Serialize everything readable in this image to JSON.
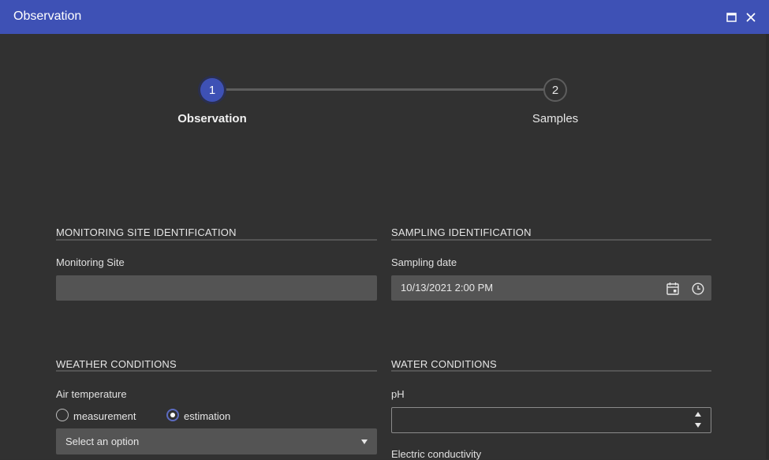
{
  "window": {
    "title": "Observation"
  },
  "stepper": {
    "steps": [
      {
        "number": "1",
        "label": "Observation"
      },
      {
        "number": "2",
        "label": "Samples"
      }
    ]
  },
  "monitoring_site": {
    "section_title": "MONITORING SITE IDENTIFICATION",
    "field_label": "Monitoring Site",
    "value": ""
  },
  "sampling": {
    "section_title": "SAMPLING IDENTIFICATION",
    "field_label": "Sampling date",
    "value": "10/13/2021 2:00 PM"
  },
  "weather": {
    "section_title": "WEATHER CONDITIONS",
    "field_label": "Air temperature",
    "options": [
      "measurement",
      "estimation"
    ],
    "selected": "estimation",
    "select_placeholder": "Select an option"
  },
  "water": {
    "section_title": "WATER CONDITIONS",
    "ph_label": "pH",
    "ph_value": "",
    "conductivity_label": "Electric conductivity"
  },
  "colors": {
    "title_bar": "#3e51b5",
    "background": "#313131",
    "accent": "#5c6bc0"
  }
}
